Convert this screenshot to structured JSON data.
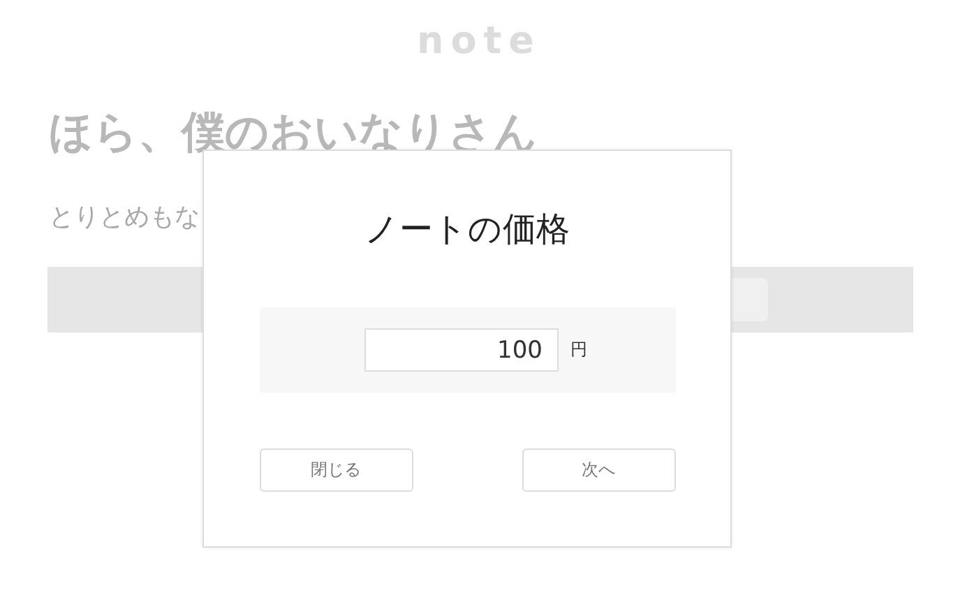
{
  "page": {
    "logo": "note",
    "title": "ほら、僕のおいなりさん",
    "subtitle": "とりとめもな"
  },
  "dialog": {
    "title": "ノートの価格",
    "price": {
      "value": "100",
      "unit": "円"
    },
    "buttons": [
      {
        "label": "閉じる"
      },
      {
        "label": "次へ"
      }
    ]
  }
}
